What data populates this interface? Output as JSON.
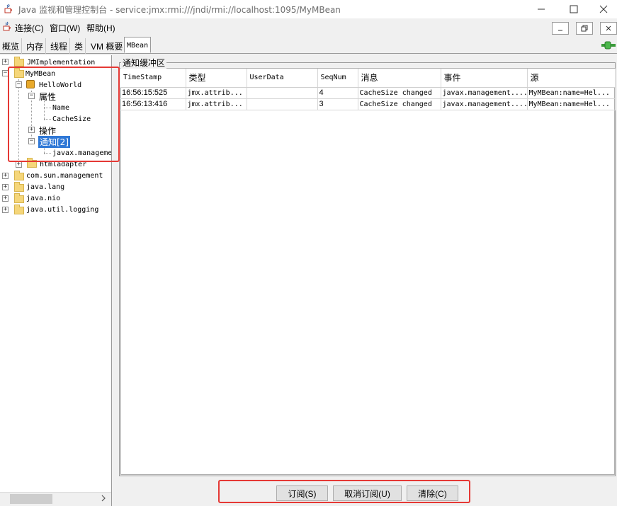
{
  "window": {
    "title": "Java 监视和管理控制台 - service:jmx:rmi:///jndi/rmi://localhost:1095/MyMBean",
    "icons": {
      "app": "java-cup-icon",
      "minimize": "minimize-icon",
      "maximize": "maximize-icon",
      "close": "close-icon"
    }
  },
  "menu": {
    "items": [
      "连接(C)",
      "窗口(W)",
      "帮助(H)"
    ]
  },
  "tabs": [
    "概览",
    "内存",
    "线程",
    "类",
    "VM 概要",
    "MBean"
  ],
  "active_tab": "MBean",
  "tree": {
    "nodes": [
      "JMImplementation",
      "MyMBean",
      "HelloWorld",
      "属性",
      "Name",
      "CacheSize",
      "操作",
      "通知[2]",
      "javax.management",
      "htmladapter",
      "com.sun.management",
      "java.lang",
      "java.nio",
      "java.util.logging"
    ],
    "selected": "通知[2]"
  },
  "notification_panel": {
    "title": "通知缓冲区",
    "columns": [
      "TimeStamp",
      "类型",
      "UserData",
      "SeqNum",
      "消息",
      "事件",
      "源"
    ],
    "rows": [
      [
        "16:56:15:525",
        "jmx.attrib...",
        "",
        "4",
        "CacheSize changed",
        "javax.management....",
        "MyMBean:name=Hel..."
      ],
      [
        "16:56:13:416",
        "jmx.attrib...",
        "",
        "3",
        "CacheSize changed",
        "javax.management....",
        "MyMBean:name=Hel..."
      ]
    ]
  },
  "buttons": {
    "subscribe": "订阅(S)",
    "unsubscribe": "取消订阅(U)",
    "clear": "清除(C)"
  },
  "colors": {
    "selection": "#2f78d6",
    "highlight": "#e53935",
    "folder": "#f5d67a"
  }
}
